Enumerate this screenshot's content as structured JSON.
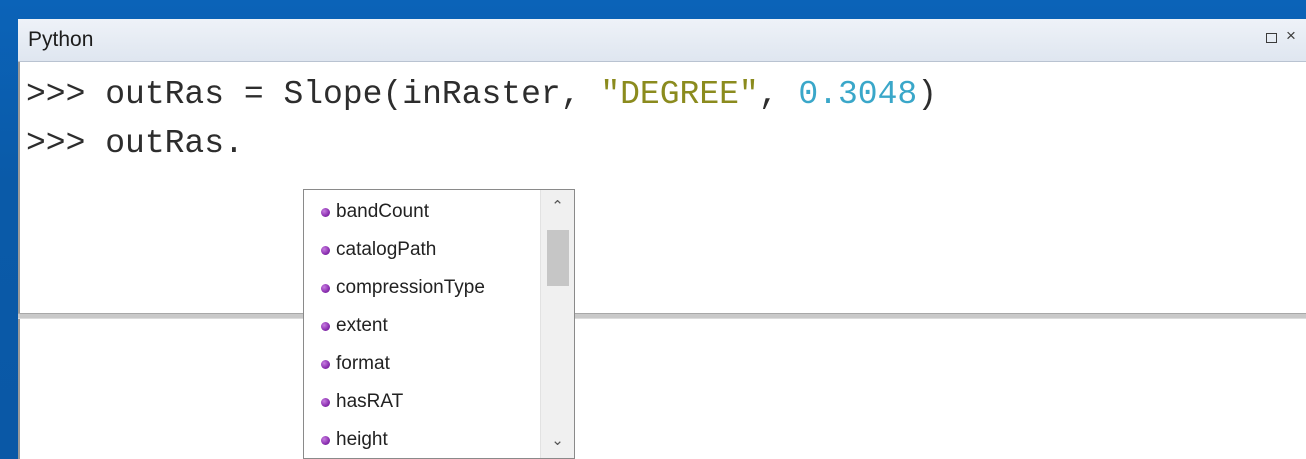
{
  "window": {
    "title": "Python",
    "restore_icon": "restore-icon",
    "close_glyph": "×"
  },
  "code": {
    "line1": {
      "prompt": ">>> ",
      "text_before": "outRas = Slope(inRaster, ",
      "string_arg": "\"DEGREE\"",
      "sep": ", ",
      "number_arg": "0.3048",
      "close": ")"
    },
    "line2": {
      "prompt": ">>> ",
      "text": "outRas."
    }
  },
  "autocomplete": {
    "items": [
      {
        "label": "bandCount",
        "icon": "property-icon"
      },
      {
        "label": "catalogPath",
        "icon": "property-icon"
      },
      {
        "label": "compressionType",
        "icon": "property-icon"
      },
      {
        "label": "extent",
        "icon": "property-icon"
      },
      {
        "label": "format",
        "icon": "property-icon"
      },
      {
        "label": "hasRAT",
        "icon": "property-icon"
      },
      {
        "label": "height",
        "icon": "property-icon"
      }
    ],
    "scroll_up_glyph": "⌃",
    "scroll_down_glyph": "⌄"
  },
  "colors": {
    "background_blue": "#0b63b8",
    "string_literal": "#8b8b1e",
    "number_literal": "#3aa7c9",
    "property_dot": "#8a2fb0"
  }
}
